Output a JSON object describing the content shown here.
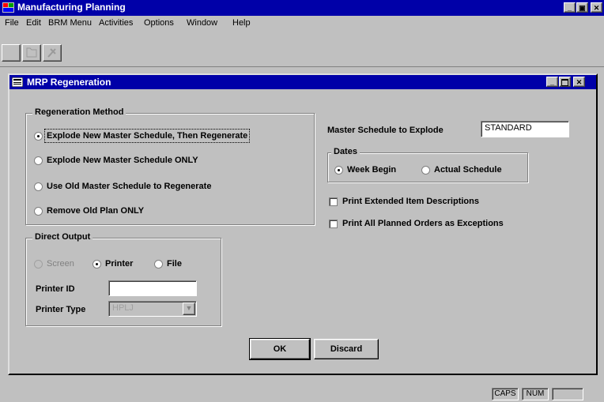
{
  "app": {
    "title": "Manufacturing Planning"
  },
  "window_buttons": {
    "minimize": "_",
    "restore": "▣",
    "close": "✕"
  },
  "menu": [
    {
      "label": "File",
      "name": "file"
    },
    {
      "label": "Edit",
      "name": "edit"
    },
    {
      "label": "BRM Menu",
      "name": "brm-menu"
    },
    {
      "label": "Activities",
      "name": "activities"
    },
    {
      "label": "Options",
      "name": "options"
    },
    {
      "label": "Window",
      "name": "window"
    },
    {
      "label": "Help",
      "name": "help"
    }
  ],
  "child": {
    "title": "MRP Regeneration"
  },
  "regen": {
    "title": "Regeneration Method",
    "options": [
      {
        "label": "Explode New Master Schedule, Then Regenerate",
        "selected": true
      },
      {
        "label": "Explode New Master Schedule ONLY",
        "selected": false
      },
      {
        "label": "Use Old Master Schedule to Regenerate",
        "selected": false
      },
      {
        "label": "Remove Old Plan ONLY",
        "selected": false
      }
    ]
  },
  "output": {
    "title": "Direct Output",
    "screen": "Screen",
    "printer": "Printer",
    "file": "File",
    "printer_id_label": "Printer ID",
    "printer_id_value": "",
    "printer_type_label": "Printer Type",
    "printer_type_value": "HPLJ"
  },
  "master": {
    "label": "Master Schedule to Explode",
    "value": "STANDARD"
  },
  "dates": {
    "title": "Dates",
    "week_begin": "Week Begin",
    "actual_schedule": "Actual Schedule"
  },
  "checks": {
    "print_extended": "Print Extended Item Descriptions",
    "print_all_planned": "Print All Planned Orders as Exceptions"
  },
  "buttons": {
    "ok": "OK",
    "discard": "Discard"
  },
  "status": {
    "caps": "CAPS",
    "num": "NUM"
  }
}
